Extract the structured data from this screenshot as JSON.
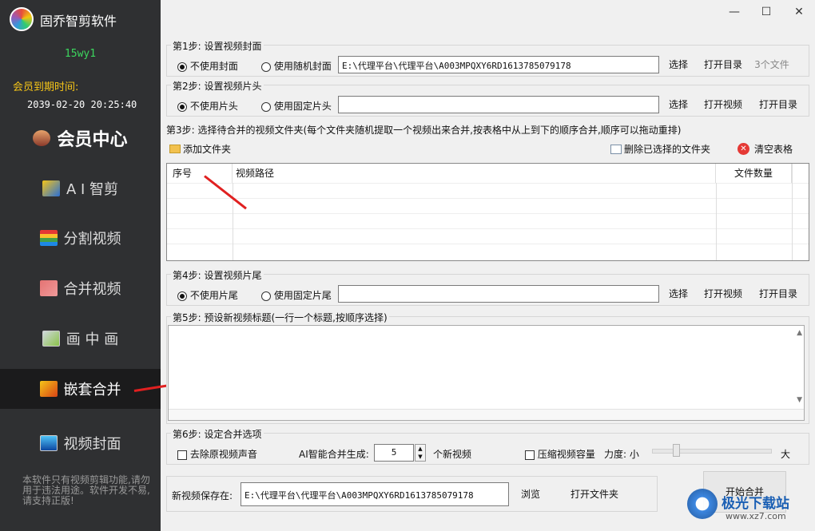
{
  "app": {
    "title": "固乔智剪软件",
    "username": "15wy1",
    "vip_label": "会员到期时间:",
    "vip_date": "2039-02-20 20:25:40"
  },
  "nav": {
    "vip_center": "会员中心",
    "items": [
      "A I 智剪",
      "分割视频",
      "合并视频",
      "画 中 画",
      "嵌套合并",
      "视频封面"
    ]
  },
  "side_note": "本软件只有视频剪辑功能,请勿用于违法用途。软件开发不易,请支持正版!",
  "window": {
    "minimize": "—",
    "maximize": "☐",
    "close": "✕"
  },
  "step1": {
    "label": "第1步: 设置视频封面",
    "opt1": "不使用封面",
    "opt2": "使用随机封面",
    "path": "E:\\代理平台\\代理平台\\A003MPQXY6RD1613785079178",
    "select": "选择",
    "open_dir": "打开目录",
    "count": "3个文件"
  },
  "step2": {
    "label": "第2步: 设置视频片头",
    "opt1": "不使用片头",
    "opt2": "使用固定片头",
    "path": "",
    "select": "选择",
    "open_video": "打开视频",
    "open_dir": "打开目录"
  },
  "step3": {
    "label": "第3步: 选择待合并的视频文件夹(每个文件夹随机提取一个视频出来合并,按表格中从上到下的顺序合并,顺序可以拖动重排)",
    "add_folder": "添加文件夹",
    "delete_selected": "删除已选择的文件夹",
    "clear_table": "清空表格",
    "columns": [
      "序号",
      "视频路径",
      "文件数量"
    ]
  },
  "step4": {
    "label": "第4步: 设置视频片尾",
    "opt1": "不使用片尾",
    "opt2": "使用固定片尾",
    "path": "",
    "select": "选择",
    "open_video": "打开视频",
    "open_dir": "打开目录"
  },
  "step5": {
    "label": "第5步: 预设新视频标题(一行一个标题,按顺序选择)"
  },
  "step6": {
    "label": "第6步: 设定合并选项",
    "remove_audio": "去除原视频声音",
    "ai_label": "AI智能合并生成:",
    "ai_count": "5",
    "ai_unit": "个新视频",
    "compress": "压缩视频容量",
    "strength_label": "力度: 小",
    "strength_max": "大",
    "strength_level": 0.2
  },
  "save": {
    "label": "新视频保存在:",
    "path": "E:\\代理平台\\代理平台\\A003MPQXY6RD1613785079178",
    "browse": "浏览",
    "open_folder": "打开文件夹"
  },
  "start": "开始合并",
  "watermark": {
    "brand": "极光下载站",
    "url": "www.xz7.com"
  },
  "colors": {
    "sidebar": "#2f3032",
    "active": "#1b1b1c",
    "username": "#3cd65e",
    "vip": "#f5c518",
    "arrow": "#e02020"
  }
}
